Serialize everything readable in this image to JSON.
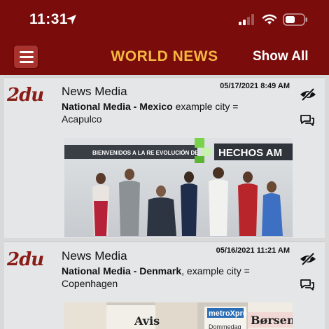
{
  "status_bar": {
    "time": "11:31",
    "icons": [
      "location-arrow-icon",
      "signal-icon",
      "wifi-icon",
      "battery-icon"
    ]
  },
  "nav": {
    "title": "WORLD NEWS",
    "show_all_label": "Show All",
    "menu_icon": "hamburger-menu-icon"
  },
  "colors": {
    "header_bg": "#7a0c0c",
    "title_color": "#f4b740",
    "card_bg": "#e4e6e8",
    "logo_color": "#8a1c16"
  },
  "cards": [
    {
      "logo": "2du",
      "title": "News Media",
      "date": "05/17/2021 8:49 AM",
      "media_bold": "National Media - Mexico",
      "desc_rest": " example city = Acapulco",
      "image_banner": "BIENVENIDOS A LA RE EVOLUCIÓN DE",
      "image_brand": "HECHOS AM"
    },
    {
      "logo": "2du",
      "title": "News Media",
      "date": "05/16/2021 11:21 AM",
      "media_bold": "National Media - Denmark",
      "desc_rest": ", example city = Copenhagen",
      "image_words": [
        "Børsen",
        "metroXpre",
        "Avis",
        "Dommedag"
      ]
    }
  ]
}
